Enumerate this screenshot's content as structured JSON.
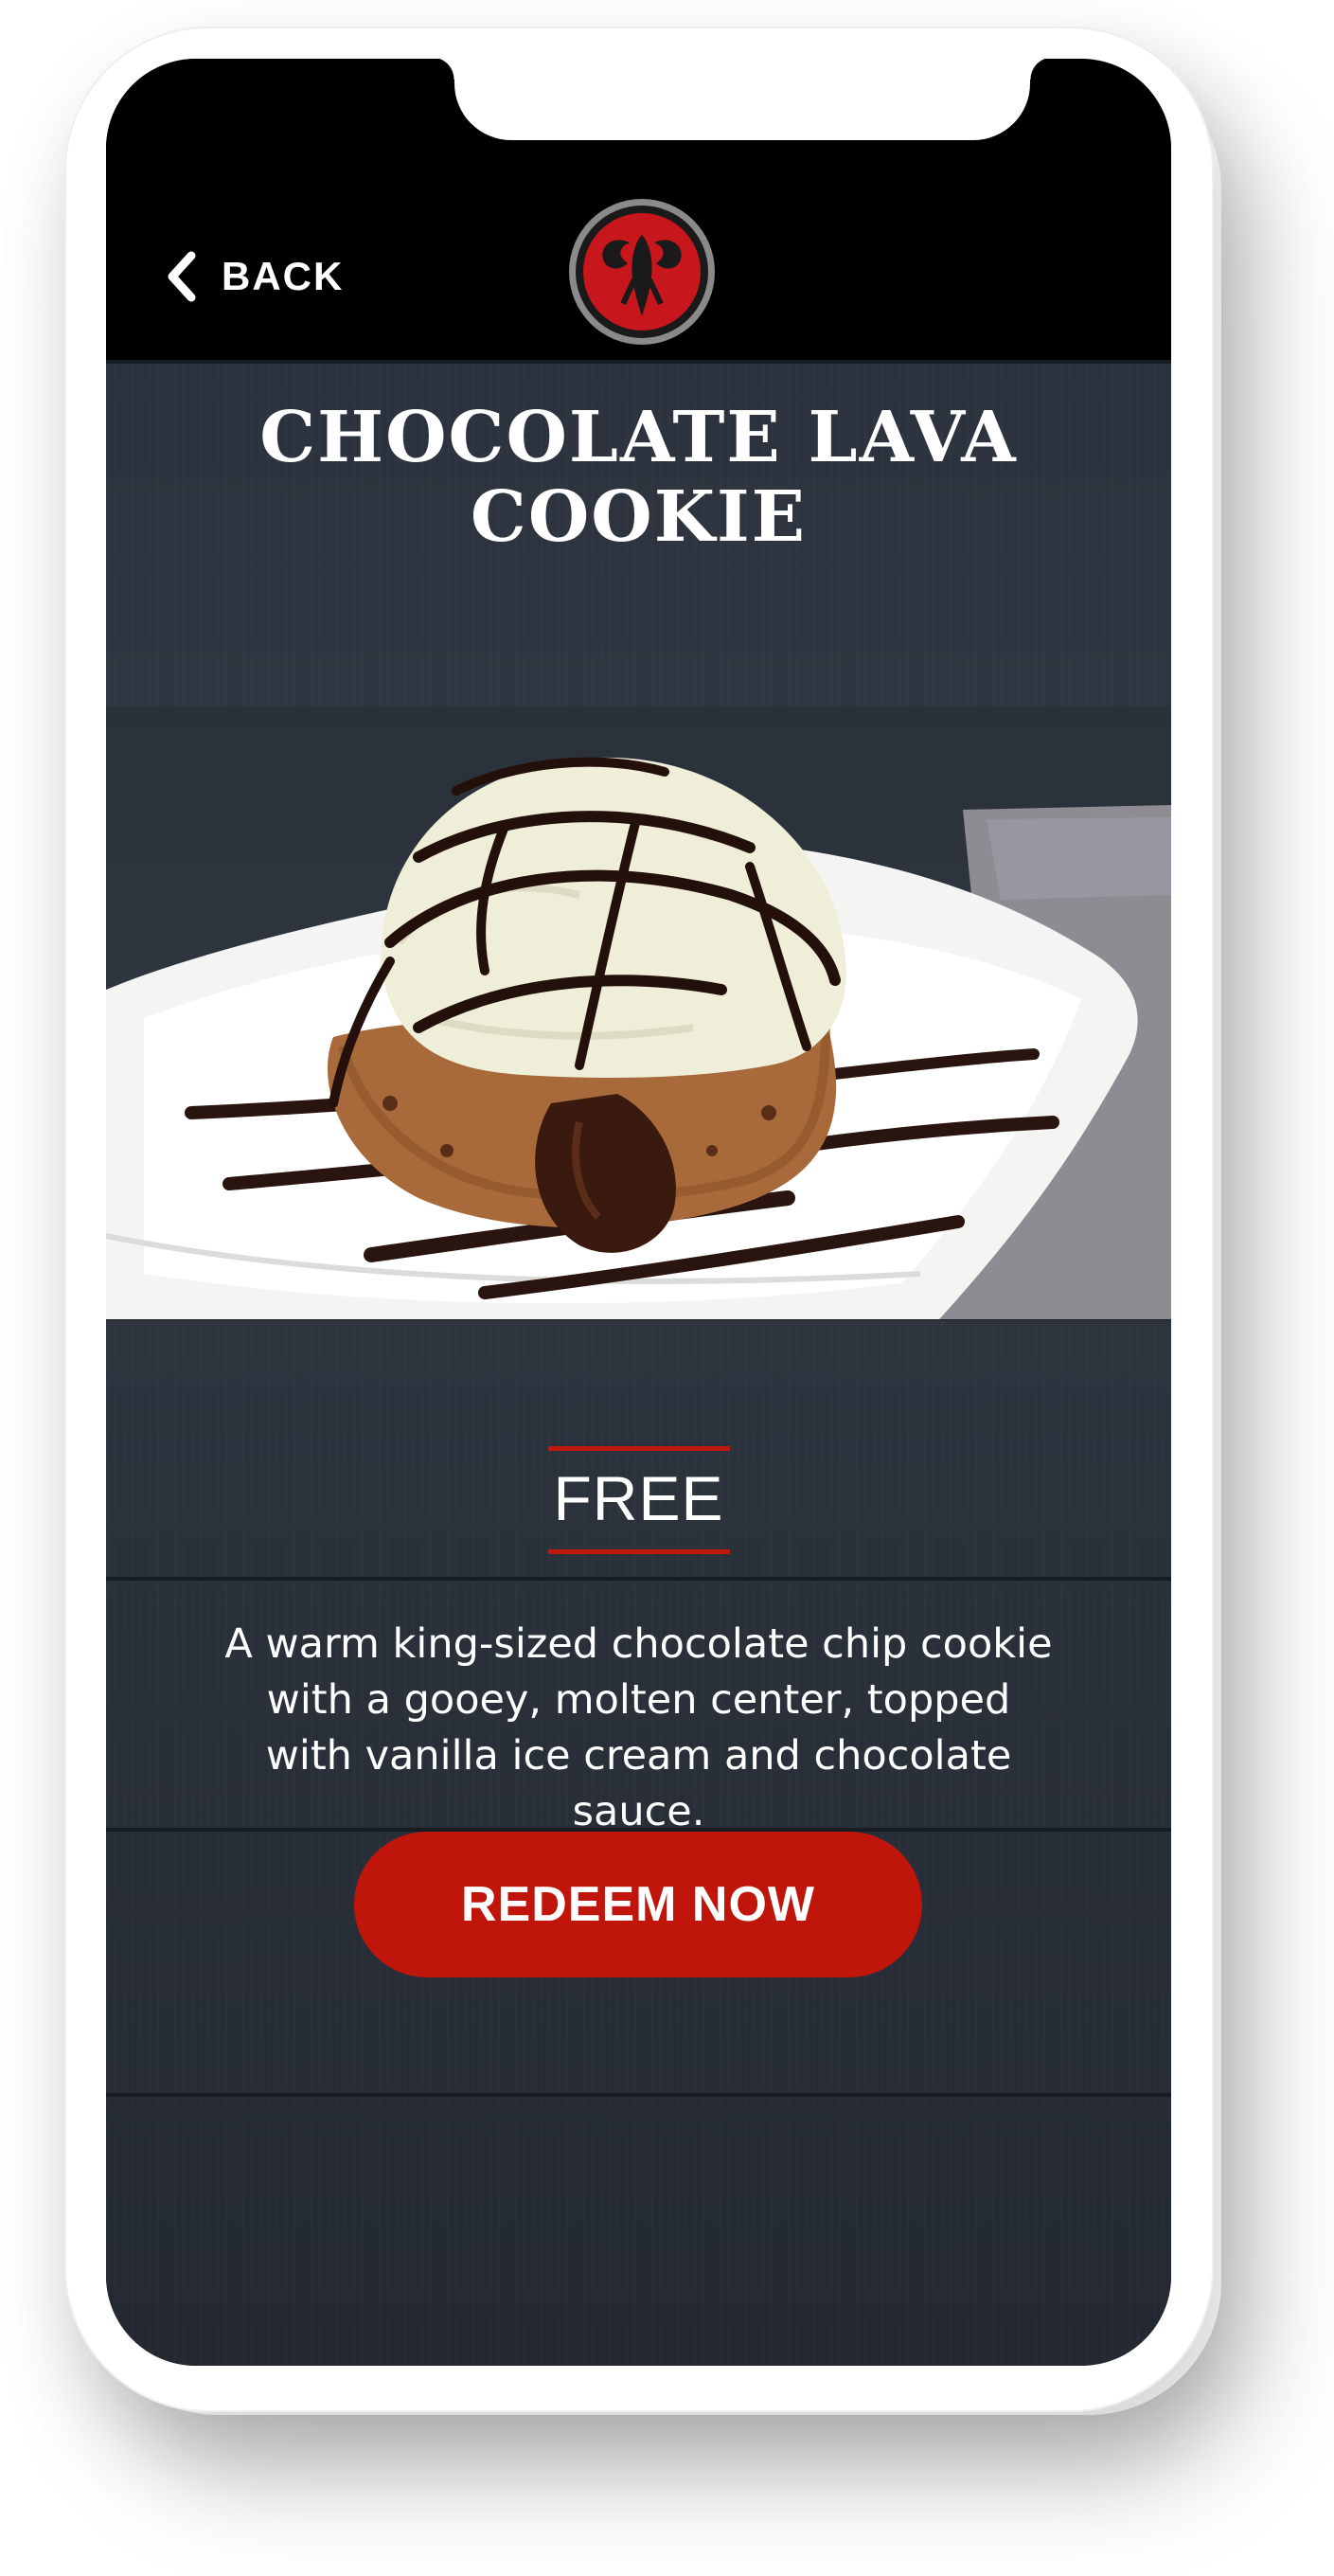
{
  "header": {
    "back_label": "BACK",
    "back_icon": "chevron-left-icon",
    "logo_icon": "lobster-logo-icon"
  },
  "offer": {
    "title_line1": "CHOCOLATE LAVA",
    "title_line2": "COOKIE",
    "price_label": "FREE",
    "description": "A warm king-sized chocolate chip cookie with a gooey, molten center, topped with vanilla ice cream and chocolate sauce.",
    "cta_label": "REDEEM NOW"
  },
  "colors": {
    "accent": "#bf150b",
    "header_bg": "#000000",
    "wood_bg": "#2f3540",
    "text": "#ffffff"
  }
}
